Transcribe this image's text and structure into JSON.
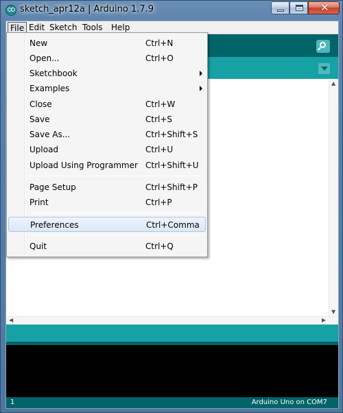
{
  "window": {
    "title": "sketch_apr12a | Arduino 1.7.9"
  },
  "menubar": {
    "file": "File",
    "edit": "Edit",
    "sketch": "Sketch",
    "tools": "Tools",
    "help": "Help"
  },
  "file_menu": {
    "items": [
      {
        "label": "New",
        "shortcut": "Ctrl+N"
      },
      {
        "label": "Open...",
        "shortcut": "Ctrl+O"
      },
      {
        "label": "Sketchbook",
        "shortcut": "",
        "submenu": true
      },
      {
        "label": "Examples",
        "shortcut": "",
        "submenu": true
      },
      {
        "label": "Close",
        "shortcut": "Ctrl+W"
      },
      {
        "label": "Save",
        "shortcut": "Ctrl+S"
      },
      {
        "label": "Save As...",
        "shortcut": "Ctrl+Shift+S"
      },
      {
        "label": "Upload",
        "shortcut": "Ctrl+U"
      },
      {
        "label": "Upload Using Programmer",
        "shortcut": "Ctrl+Shift+U"
      },
      {
        "label": "Page Setup",
        "shortcut": "Ctrl+Shift+P"
      },
      {
        "label": "Print",
        "shortcut": "Ctrl+P"
      },
      {
        "label": "Preferences",
        "shortcut": "Ctrl+Comma",
        "highlighted": true
      },
      {
        "label": "Quit",
        "shortcut": "Ctrl+Q"
      }
    ]
  },
  "footer": {
    "line_number": "1",
    "board": "Arduino Uno on COM7"
  },
  "colors": {
    "toolbar": "#006468",
    "tabbar": "#17a1a5",
    "console": "#000000"
  }
}
